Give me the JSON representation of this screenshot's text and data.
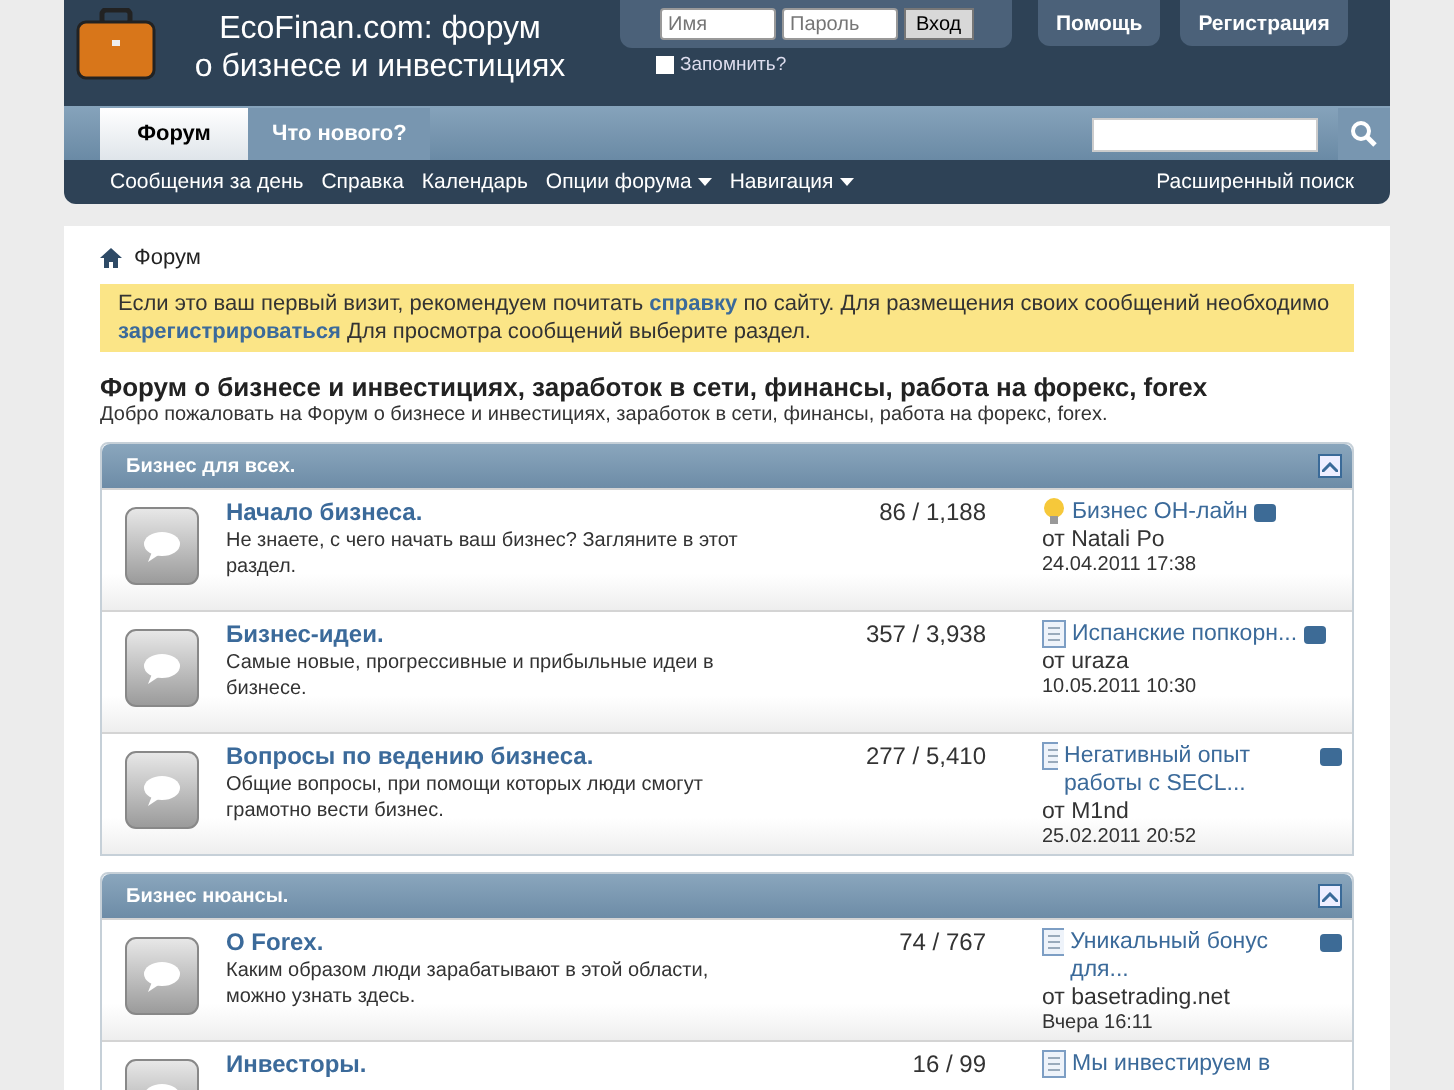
{
  "header": {
    "site_title": [
      "EcoFinan.com: форум",
      "о бизнесе и инвестициях"
    ],
    "login": {
      "username_placeholder": "Имя",
      "password_placeholder": "Пароль",
      "submit": "Вход",
      "remember": {
        "label": "Запомнить?",
        "checked": false
      }
    },
    "buttons": [
      "Помощь",
      "Регистрация"
    ]
  },
  "tabs": [
    {
      "label": "Форум",
      "selected": true
    },
    {
      "label": "Что нового?",
      "selected": false
    }
  ],
  "subnav": {
    "items": [
      {
        "label": "Сообщения за день",
        "dropdown": false
      },
      {
        "label": "Справка",
        "dropdown": false
      },
      {
        "label": "Календарь",
        "dropdown": false
      },
      {
        "label": "Опции форума",
        "dropdown": true
      },
      {
        "label": "Навигация",
        "dropdown": true
      }
    ],
    "advanced_search": "Расширенный поиск"
  },
  "breadcrumb": "Форум",
  "notice": {
    "parts": [
      {
        "text": "Если это ваш первый визит, рекомендуем почитать ",
        "link": false
      },
      {
        "text": "справку",
        "link": true
      },
      {
        "text": " по сайту. Для размещения своих сообщений необходимо ",
        "link": false
      },
      {
        "text": "зарегистрироваться",
        "link": true
      },
      {
        "text": " Для просмотра сообщений выберите раздел.",
        "link": false
      }
    ]
  },
  "forum_title": "Форум о бизнесе и инвестициях, заработок в сети, финансы, работа на форекс, forex",
  "forum_description": "Добро пожаловать на Форум о бизнесе и инвестициях, заработок в сети, финансы, работа на форекс, forex.",
  "categories": [
    {
      "title": "Бизнес для всех.",
      "expanded": true,
      "forums": [
        {
          "title": "Начало бизнеса.",
          "description": "Не знаете, с чего начать ваш бизнес? Загляните в этот раздел.",
          "stats": "86 / 1,188",
          "last_post": {
            "kind": "bulb",
            "title": "Бизнес ОН-лайн",
            "author": "от Natali Po",
            "date": "24.04.2011 17:38"
          }
        },
        {
          "title": "Бизнес-идеи.",
          "description": "Самые новые, прогрессивные и прибыльные идеи в бизнесе.",
          "stats": "357 / 3,938",
          "last_post": {
            "kind": "doc",
            "title": "Испанские попкорн...",
            "author": "от uraza",
            "date": "10.05.2011 10:30"
          }
        },
        {
          "title": "Вопросы по ведению бизнеса.",
          "description": "Общие вопросы, при помощи которых люди смогут грамотно вести бизнес.",
          "stats": "277 / 5,410",
          "last_post": {
            "kind": "doc",
            "title": "Негативный опыт работы с SECL...",
            "author": "от M1nd",
            "date": "25.02.2011 20:52"
          }
        }
      ]
    },
    {
      "title": "Бизнес нюансы.",
      "expanded": true,
      "forums": [
        {
          "title": "О Forex.",
          "description": "Каким образом люди зарабатывают в этой области, можно узнать здесь.",
          "stats": "74 / 767",
          "last_post": {
            "kind": "doc",
            "title": "Уникальный бонус для...",
            "author": "от basetrading.net",
            "date": "Вчера 16:11"
          }
        },
        {
          "title": "Инвесторы.",
          "stats": "16 / 99",
          "last_post": {
            "kind": "doc",
            "title": "Мы инвестируем в"
          }
        }
      ]
    }
  ]
}
